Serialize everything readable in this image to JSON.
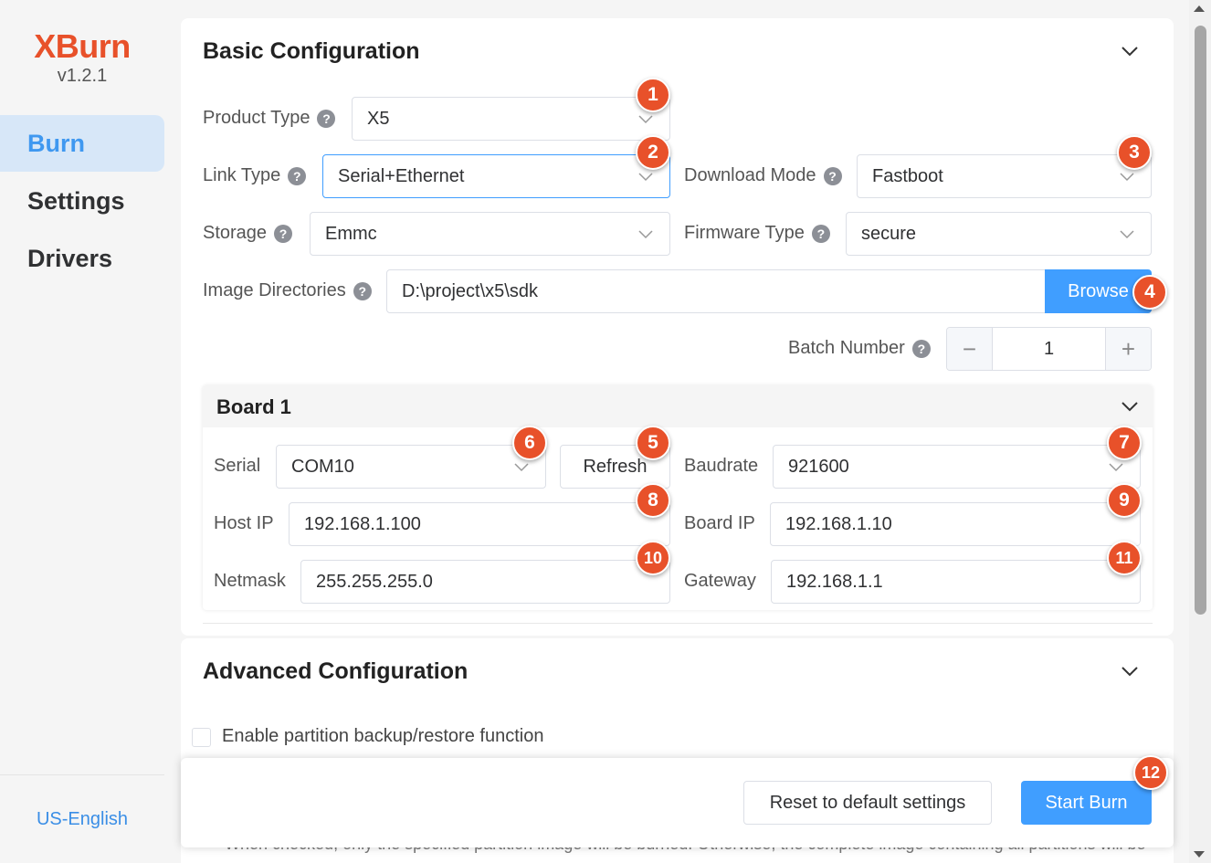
{
  "app": {
    "name": "XBurn",
    "version": "v1.2.1",
    "language": "US-English"
  },
  "nav": {
    "burn": "Burn",
    "settings": "Settings",
    "drivers": "Drivers"
  },
  "basic": {
    "title": "Basic Configuration",
    "product_type_label": "Product Type",
    "product_type_value": "X5",
    "link_type_label": "Link Type",
    "link_type_value": "Serial+Ethernet",
    "download_mode_label": "Download Mode",
    "download_mode_value": "Fastboot",
    "storage_label": "Storage",
    "storage_value": "Emmc",
    "firmware_type_label": "Firmware Type",
    "firmware_type_value": "secure",
    "image_dir_label": "Image Directories",
    "image_dir_value": "D:\\project\\x5\\sdk",
    "browse_label": "Browse",
    "batch_label": "Batch Number",
    "batch_value": "1",
    "minus": "−",
    "plus": "+"
  },
  "board": {
    "title": "Board 1",
    "serial_label": "Serial",
    "serial_value": "COM10",
    "refresh_label": "Refresh",
    "baudrate_label": "Baudrate",
    "baudrate_value": "921600",
    "host_ip_label": "Host IP",
    "host_ip_value": "192.168.1.100",
    "board_ip_label": "Board IP",
    "board_ip_value": "192.168.1.10",
    "netmask_label": "Netmask",
    "netmask_value": "255.255.255.0",
    "gateway_label": "Gateway",
    "gateway_value": "192.168.1.1"
  },
  "advanced": {
    "title": "Advanced Configuration",
    "partition_checkbox_label": "Enable partition backup/restore function",
    "hint": "When checked, only the specified partition image will be burned. Otherwise, the complete image containing all partitions will be"
  },
  "footer": {
    "reset_label": "Reset to default settings",
    "start_label": "Start Burn"
  },
  "badges": [
    "1",
    "2",
    "3",
    "4",
    "5",
    "6",
    "7",
    "8",
    "9",
    "10",
    "11",
    "12"
  ],
  "colors": {
    "brand": "#e8512a",
    "primary": "#409eff",
    "badge": "#e8512a",
    "nav_active_bg": "#d7e7f8"
  },
  "icons": {
    "help": "question-circle-icon",
    "dropdown": "chevron-down-icon",
    "collapse": "chevron-down-icon"
  }
}
